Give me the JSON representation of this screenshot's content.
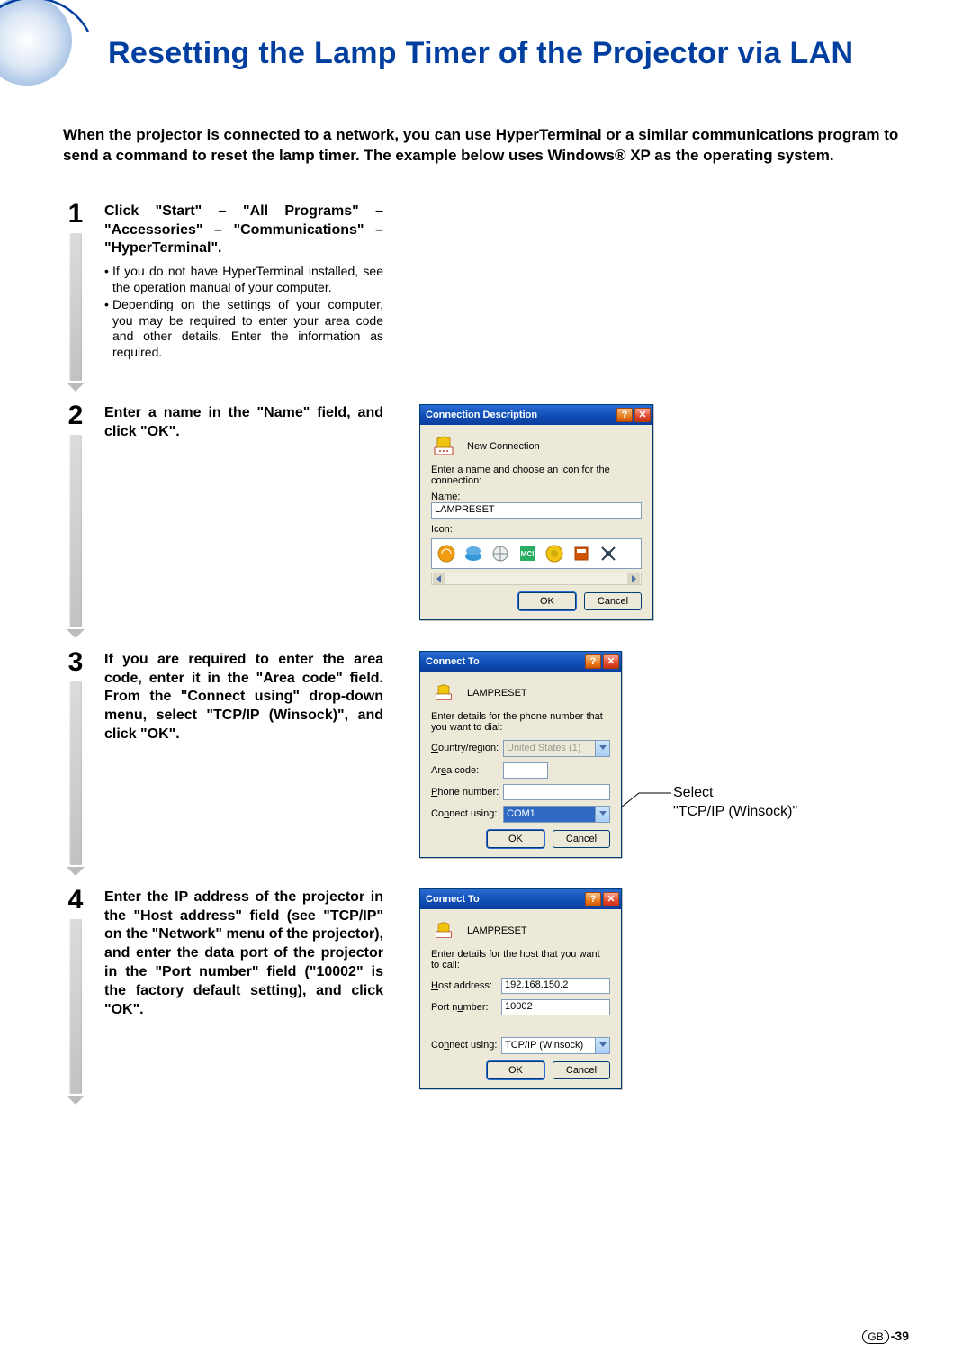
{
  "title": "Resetting the Lamp Timer of the Projector via LAN",
  "intro": "When the projector is connected to a network, you can use HyperTerminal or a similar communications program to send a command to reset the lamp timer. The example below uses Windows® XP as the operating system.",
  "steps": {
    "s1": {
      "num": "1",
      "heading": "Click \"Start\" – \"All Programs\" – \"Accessories\" – \"Communications\" – \"HyperTerminal\".",
      "bullets": [
        "If you do not have HyperTerminal installed, see the operation manual of your computer.",
        "Depending on the settings of your computer, you may be required to enter your area code and other details. Enter the information as required."
      ]
    },
    "s2": {
      "num": "2",
      "heading": "Enter a name in the \"Name\" field, and click \"OK\"."
    },
    "s3": {
      "num": "3",
      "heading": "If you are required to enter the area code, enter it in the \"Area code\" field. From the \"Connect using\" drop-down menu, select \"TCP/IP (Winsock)\", and click \"OK\"."
    },
    "s4": {
      "num": "4",
      "heading": "Enter the IP address of the projector in the \"Host address\" field (see \"TCP/IP\" on the \"Network\" menu of the projector), and enter the data port of the projector in the \"Port number\" field (\"10002\" is the factory default setting), and click \"OK\"."
    }
  },
  "dialogs": {
    "conn_desc": {
      "title": "Connection Description",
      "sub": "New Connection",
      "prompt": "Enter a name and choose an icon for the connection:",
      "name_label": "Name:",
      "name_value": "LAMPRESET",
      "icon_label": "Icon:",
      "ok": "OK",
      "cancel": "Cancel"
    },
    "connect_to_1": {
      "title": "Connect To",
      "sub": "LAMPRESET",
      "prompt": "Enter details for the phone number that you want to dial:",
      "country_label": "Country/region:",
      "country_value": "United States (1)",
      "areacode_label": "Area code:",
      "areacode_value": "",
      "phone_label": "Phone number:",
      "phone_value": "",
      "connect_label": "Connect using:",
      "connect_value": "COM1",
      "ok": "OK",
      "cancel": "Cancel"
    },
    "connect_to_2": {
      "title": "Connect To",
      "sub": "LAMPRESET",
      "prompt": "Enter details for the host that you want to call:",
      "host_label": "Host address:",
      "host_value": "192.168.150.2",
      "port_label": "Port number:",
      "port_value": "10002",
      "connect_label": "Connect using:",
      "connect_value": "TCP/IP (Winsock)",
      "ok": "OK",
      "cancel": "Cancel"
    }
  },
  "annotation": {
    "line1": "Select",
    "line2": "\"TCP/IP (Winsock)\""
  },
  "footer": {
    "gb": "GB",
    "page": "-39"
  }
}
